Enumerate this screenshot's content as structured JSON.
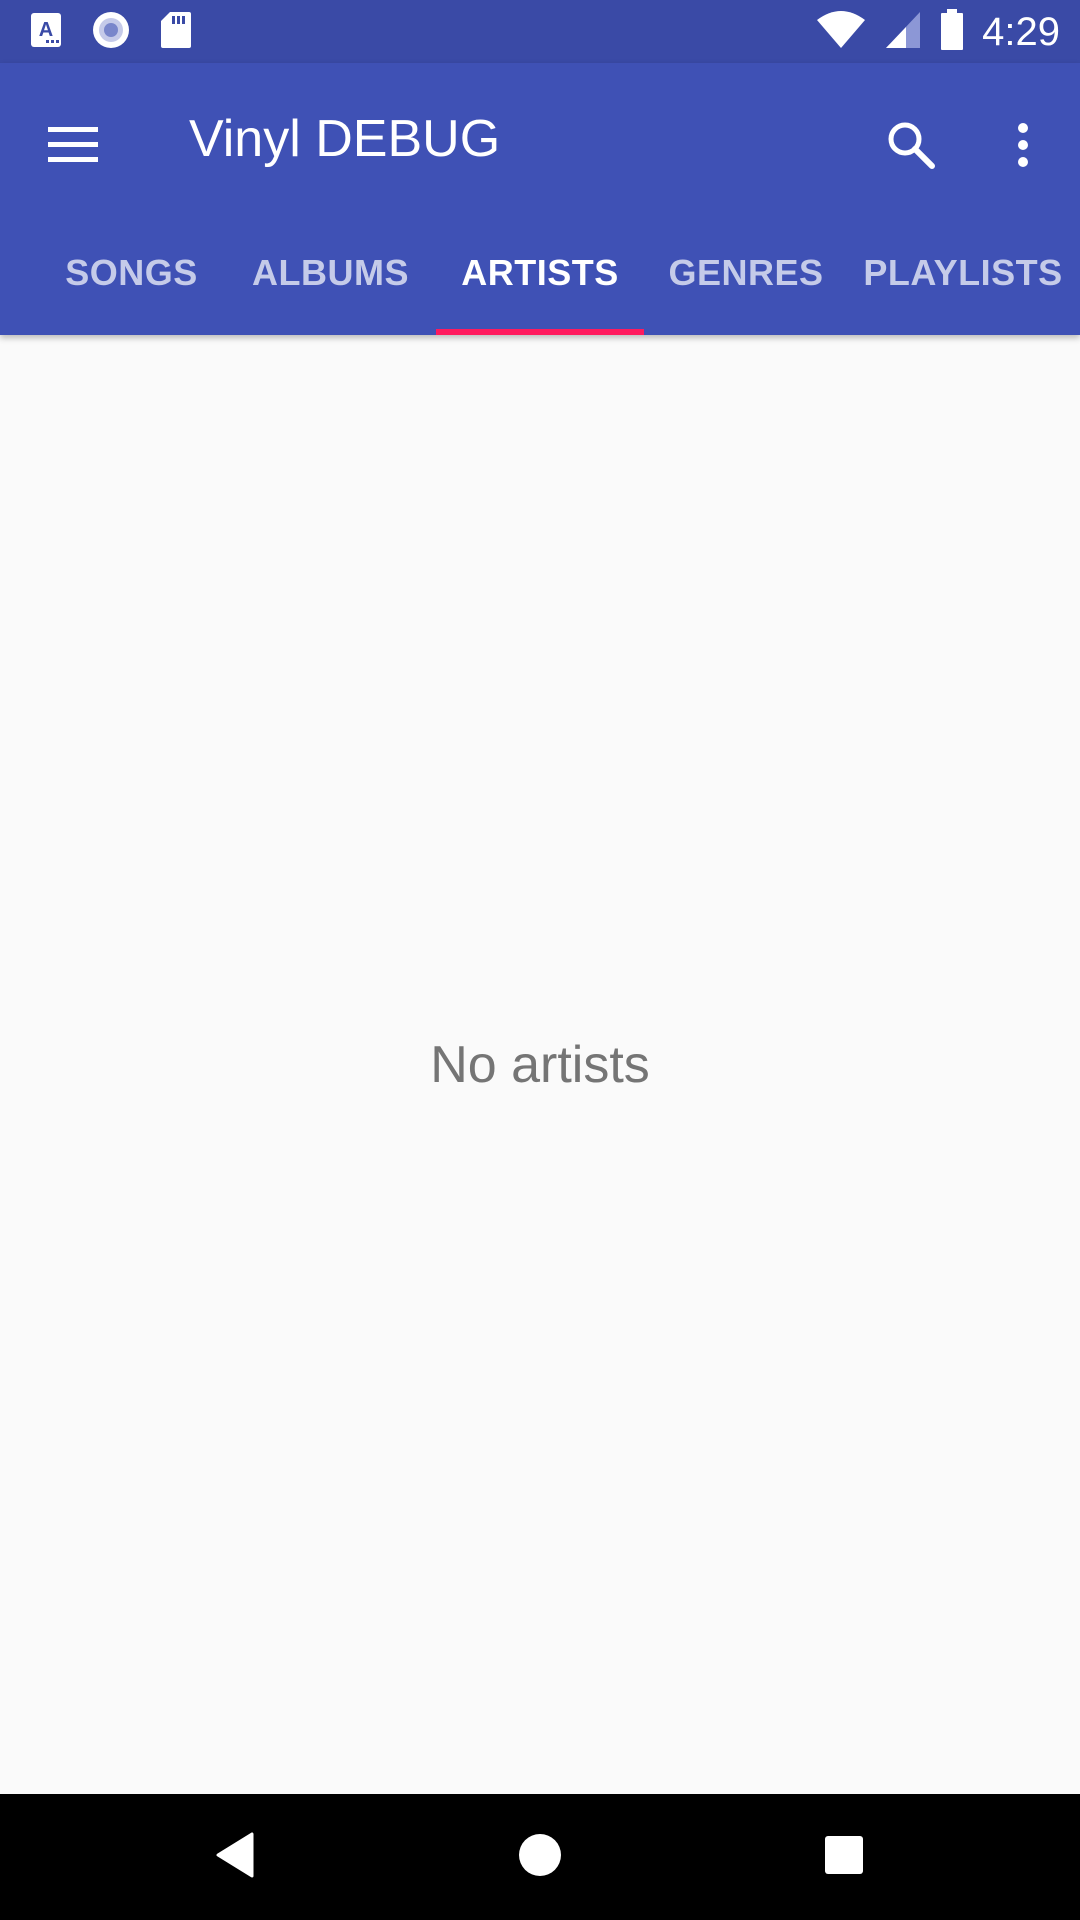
{
  "status_bar": {
    "time": "4:29",
    "left_icons": [
      "app-a-icon",
      "record-icon",
      "sd-card-icon"
    ],
    "right_icons": [
      "wifi-icon",
      "cell-signal-icon",
      "battery-icon"
    ]
  },
  "toolbar": {
    "title": "Vinyl DEBUG",
    "menu_icon": "hamburger-icon",
    "search_icon": "search-icon",
    "more_icon": "more-vert-icon"
  },
  "tabs": [
    {
      "label": "SONGS",
      "active": false
    },
    {
      "label": "ALBUMS",
      "active": false
    },
    {
      "label": "ARTISTS",
      "active": true
    },
    {
      "label": "GENRES",
      "active": false
    },
    {
      "label": "PLAYLISTS",
      "active": false
    }
  ],
  "content": {
    "empty_message": "No artists"
  },
  "navigation": {
    "back_icon": "back-icon",
    "home_icon": "home-icon",
    "recents_icon": "recents-icon"
  },
  "colors": {
    "primary": "#3f51b5",
    "primary_dark": "#3a4aa6",
    "accent": "#ff1a5e",
    "background": "#fafafa",
    "empty_text": "#757575"
  }
}
